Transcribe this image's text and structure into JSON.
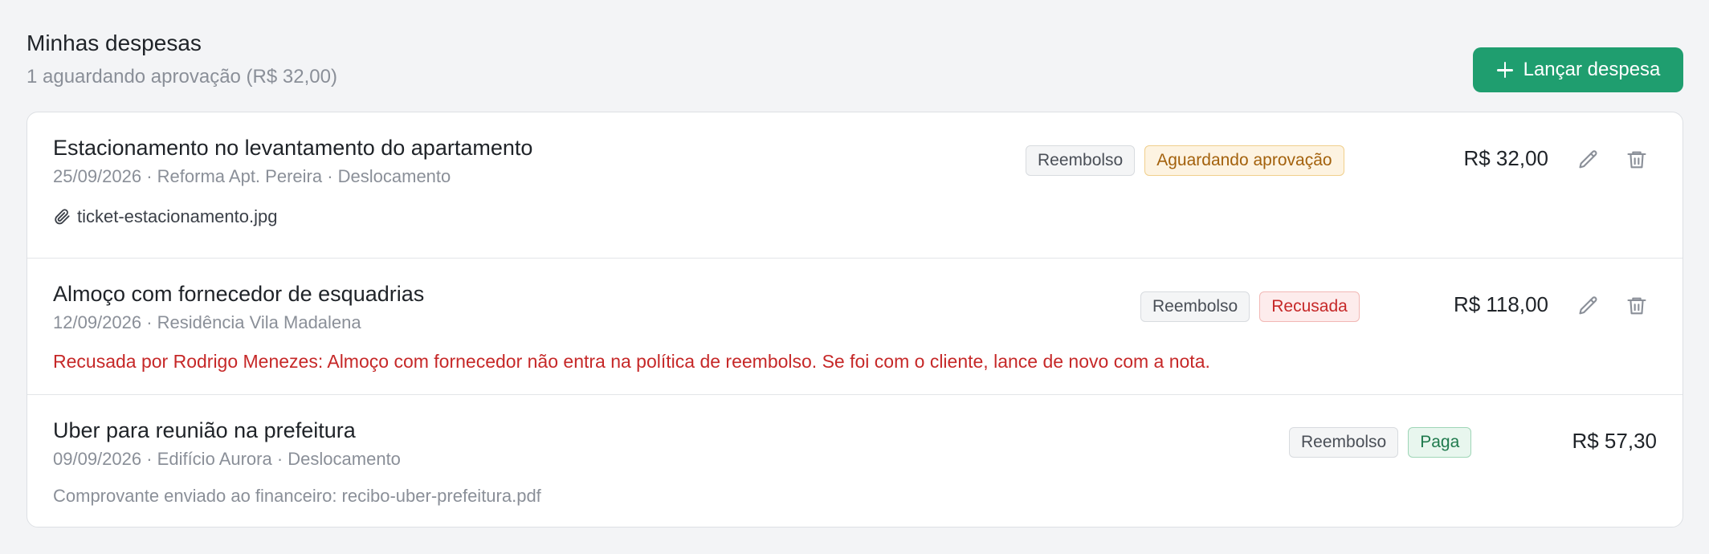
{
  "header": {
    "title": "Minhas despesas",
    "subtitle": "1 aguardando aprovação (R$ 32,00)",
    "add_button_label": "Lançar despesa",
    "add_button_icon": "plus-icon"
  },
  "colors": {
    "accent": "#1f9e6f",
    "warning": "#a3610c",
    "danger": "#c62828",
    "success": "#1f7a4d"
  },
  "expenses": [
    {
      "title": "Estacionamento no levantamento do apartamento",
      "meta": "25/09/2026 · Reforma Apt. Pereira · Deslocamento",
      "type_badge": "Reembolso",
      "status_badge": "Aguardando aprovação",
      "amount": "R$ 32,00",
      "attachment": "ticket-estacionamento.jpg",
      "attachment_icon": "paperclip-icon",
      "edit_icon": "pencil-icon",
      "delete_icon": "trash-icon"
    },
    {
      "title": "Almoço com fornecedor de esquadrias",
      "meta": "12/09/2026 · Residência Vila Madalena",
      "type_badge": "Reembolso",
      "status_badge": "Recusada",
      "amount": "R$ 118,00",
      "rejection_note": "Recusada por Rodrigo Menezes: Almoço com fornecedor não entra na política de reembolso. Se foi com o cliente, lance de novo com a nota.",
      "edit_icon": "pencil-icon",
      "delete_icon": "trash-icon"
    },
    {
      "title": "Uber para reunião na prefeitura",
      "meta": "09/09/2026 · Edifício Aurora · Deslocamento",
      "type_badge": "Reembolso",
      "status_badge": "Paga",
      "amount": "R$ 57,30",
      "receipt_note": "Comprovante enviado ao financeiro: recibo-uber-prefeitura.pdf"
    }
  ]
}
